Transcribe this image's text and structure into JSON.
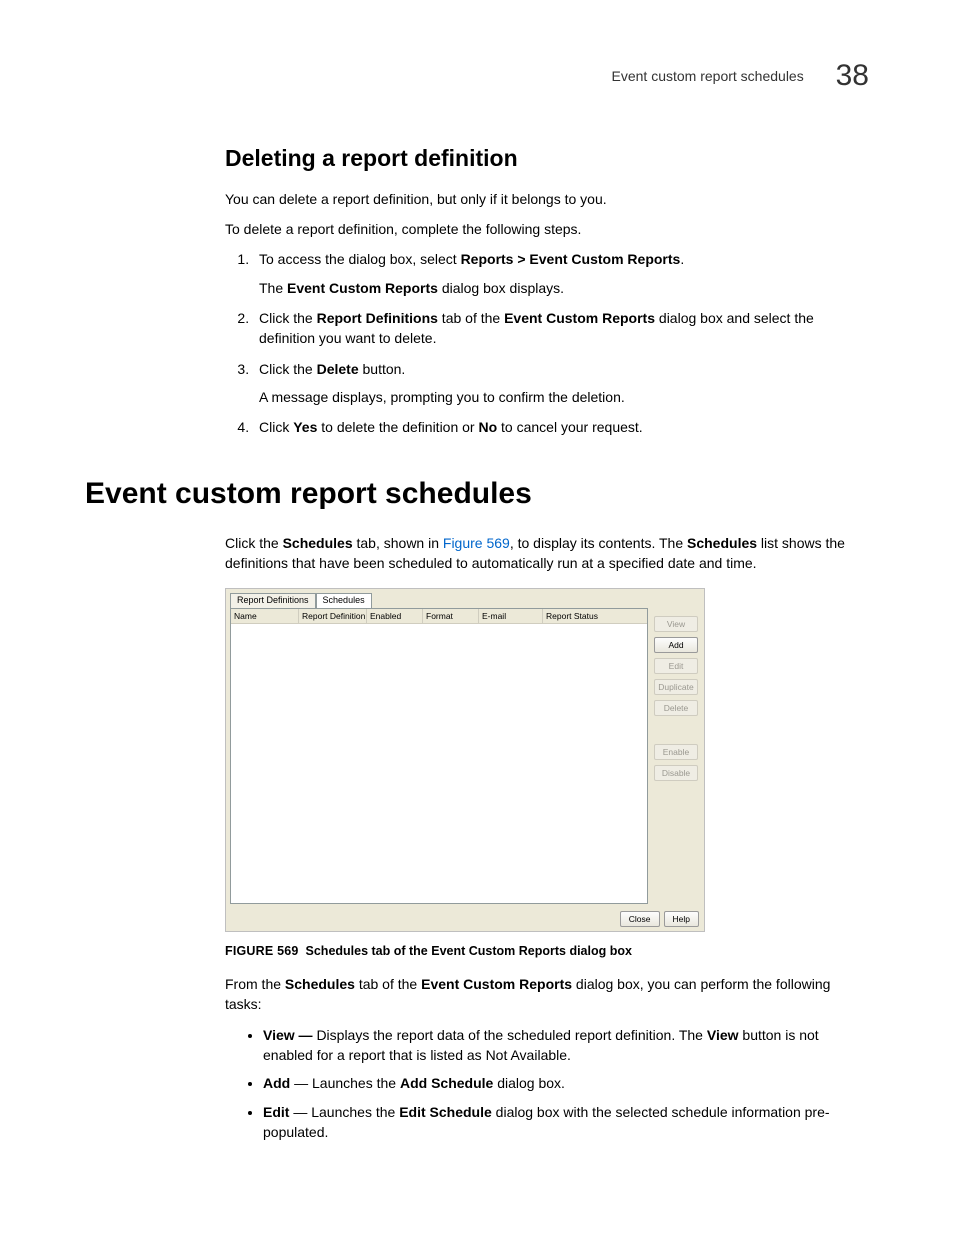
{
  "header": {
    "running_text": "Event custom report schedules",
    "chapter_number": "38"
  },
  "section1": {
    "title": "Deleting a report definition",
    "intro1": "You can delete a report definition, but only if it belongs to you.",
    "intro2": "To delete a report definition, complete the following steps.",
    "step1_prefix": "To access the dialog box, select ",
    "step1_bold": "Reports > Event Custom Reports",
    "step1_suffix": ".",
    "step1_sub_prefix": "The ",
    "step1_sub_bold": "Event Custom Reports",
    "step1_sub_suffix": " dialog box displays.",
    "step2_a": "Click the ",
    "step2_b": "Report Definitions",
    "step2_c": " tab of the ",
    "step2_d": "Event Custom Reports",
    "step2_e": " dialog box and select the definition you want to delete.",
    "step3_a": "Click the ",
    "step3_b": "Delete",
    "step3_c": " button.",
    "step3_sub": "A message displays, prompting you to confirm the deletion.",
    "step4_a": "Click ",
    "step4_b": "Yes",
    "step4_c": " to delete the definition or ",
    "step4_d": "No",
    "step4_e": " to cancel your request."
  },
  "section2": {
    "title": "Event custom report schedules",
    "para_a": "Click the ",
    "para_b": "Schedules",
    "para_c": " tab, shown in ",
    "para_xref": "Figure 569",
    "para_d": ", to display its contents. The ",
    "para_e": "Schedules",
    "para_f": " list shows the definitions that have been scheduled to automatically run at a specified date and time."
  },
  "dialog": {
    "tab1": "Report Definitions",
    "tab2": "Schedules",
    "col1": "Name",
    "col2": "Report Definition",
    "col3": "Enabled",
    "col4": "Format",
    "col5": "E-mail",
    "col6": "Report Status",
    "btn_view": "View",
    "btn_add": "Add",
    "btn_edit": "Edit",
    "btn_duplicate": "Duplicate",
    "btn_delete": "Delete",
    "btn_enable": "Enable",
    "btn_disable": "Disable",
    "btn_close": "Close",
    "btn_help": "Help"
  },
  "figure": {
    "label": "FIGURE 569",
    "caption": "Schedules tab of the Event Custom Reports dialog box"
  },
  "after_figure": {
    "para_a": "From the ",
    "para_b": "Schedules",
    "para_c": " tab of the ",
    "para_d": "Event Custom Reports",
    "para_e": " dialog box, you can perform the following tasks:",
    "b1_a": "View — ",
    "b1_b": "Displays the report data of the scheduled report definition. The ",
    "b1_c": "View",
    "b1_d": " button is not enabled for a report that is listed as Not Available.",
    "b2_a": "Add",
    "b2_b": " — Launches the ",
    "b2_c": "Add Schedule",
    "b2_d": " dialog box.",
    "b3_a": "Edit",
    "b3_b": " — Launches the ",
    "b3_c": "Edit Schedule",
    "b3_d": " dialog box with the selected schedule information pre-populated."
  }
}
